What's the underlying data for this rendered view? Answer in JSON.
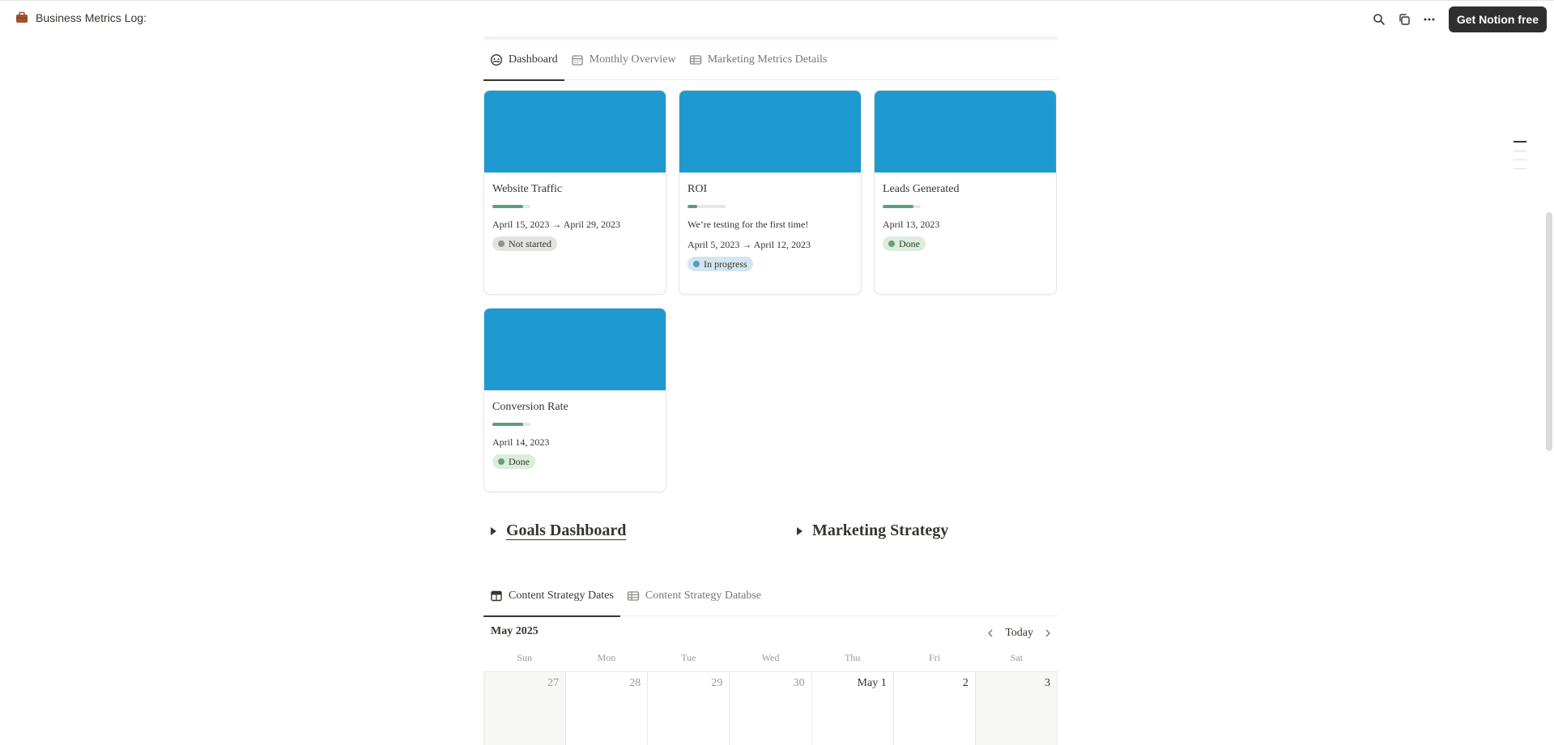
{
  "header": {
    "title": "Business Metrics Log:",
    "icon": "briefcase-icon",
    "cta_label": "Get Notion free"
  },
  "colors": {
    "cover": "#1e9ad0",
    "progress": "#5aa076",
    "cta_bg": "#2f2f2f"
  },
  "tabs1": [
    {
      "label": "Dashboard",
      "icon": "dashboard-icon",
      "active": true
    },
    {
      "label": "Monthly Overview",
      "icon": "calendar-icon",
      "active": false
    },
    {
      "label": "Marketing Metrics Details",
      "icon": "table-icon",
      "active": false
    }
  ],
  "cards": [
    {
      "title": "Website Traffic",
      "progress": 0.8,
      "lines": [
        "April 15, 2023 → April 29, 2023"
      ],
      "status": "Not started"
    },
    {
      "title": "ROI",
      "progress": 0.25,
      "lines": [
        "We’re testing for the first time!",
        "April 5, 2023 → April 12, 2023"
      ],
      "status": "In progress"
    },
    {
      "title": "Leads Generated",
      "progress": 0.8,
      "lines": [
        "April 13, 2023"
      ],
      "status": "Done"
    },
    {
      "title": "Conversion Rate",
      "progress": 0.8,
      "lines": [
        "April 14, 2023"
      ],
      "status": "Done"
    }
  ],
  "status_styles": {
    "Not started": {
      "bg": "#e3e2e0",
      "dot": "#91918e"
    },
    "In progress": {
      "bg": "#d3e5ef",
      "dot": "#5b97bd"
    },
    "Done": {
      "bg": "#dbeddb",
      "dot": "#6c9b7d"
    }
  },
  "toggles": {
    "goals": "Goals Dashboard",
    "marketing": "Marketing Strategy"
  },
  "tabs2": [
    {
      "label": "Content Strategy Dates",
      "icon": "board-icon",
      "active": true
    },
    {
      "label": "Content Strategy Databse",
      "icon": "table-icon",
      "active": false
    }
  ],
  "calendar": {
    "month": "May 2025",
    "today_label": "Today",
    "weekdays": [
      "Sun",
      "Mon",
      "Tue",
      "Wed",
      "Thu",
      "Fri",
      "Sat"
    ],
    "days": [
      {
        "label": "27",
        "muted": true
      },
      {
        "label": "28",
        "muted": true
      },
      {
        "label": "29",
        "muted": true
      },
      {
        "label": "30",
        "muted": true
      },
      {
        "label": "May 1",
        "muted": false
      },
      {
        "label": "2",
        "muted": false
      },
      {
        "label": "3",
        "muted": false
      }
    ]
  }
}
